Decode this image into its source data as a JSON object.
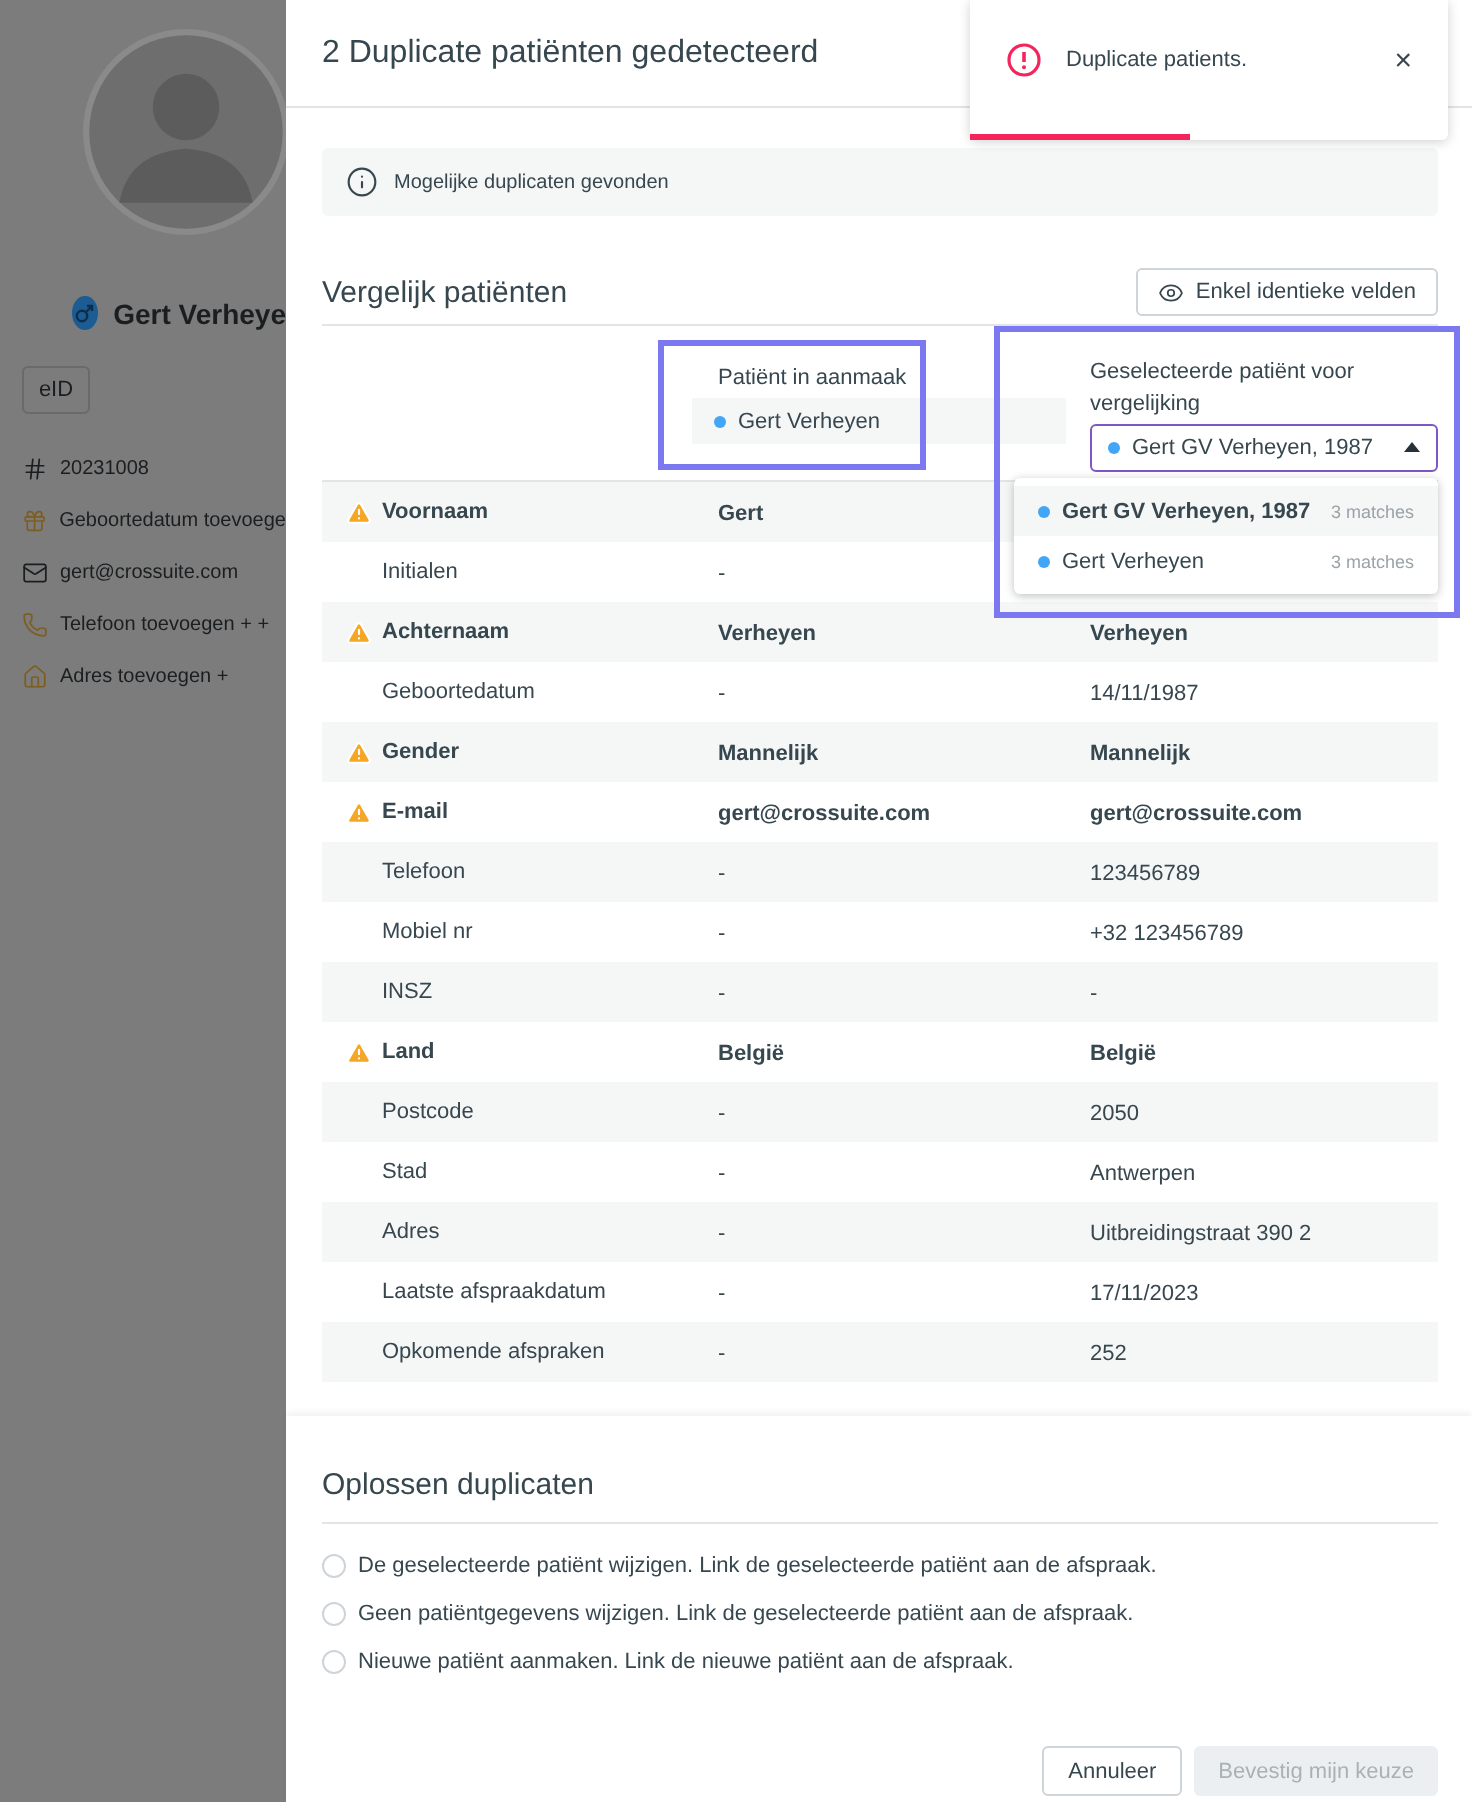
{
  "sidebar": {
    "name": "Gert Verheye",
    "eid_button": "eID",
    "items": [
      {
        "kind": "number",
        "text": "20231008"
      },
      {
        "kind": "birthday",
        "text": "Geboortedatum toevoege"
      },
      {
        "kind": "email",
        "text": "gert@crossuite.com"
      },
      {
        "kind": "phone",
        "text": "Telefoon toevoegen + +"
      },
      {
        "kind": "address",
        "text": "Adres toevoegen +"
      }
    ]
  },
  "dialog": {
    "title": "2 Duplicate patiënten gedetecteerd",
    "info": "Mogelijke duplicaten gevonden",
    "compare_title": "Vergelijk patiënten",
    "filter_button": "Enkel identieke velden",
    "created_column": {
      "label": "Patiënt in aanmaak",
      "patient": "Gert Verheyen"
    },
    "selected_column": {
      "label": "Geselecteerde patiënt voor vergelijking",
      "value": "Gert GV Verheyen, 1987",
      "options": [
        {
          "name": "Gert GV Verheyen, 1987",
          "matches": "3 matches",
          "selected": true
        },
        {
          "name": "Gert Verheyen",
          "matches": "3 matches",
          "selected": false
        }
      ]
    },
    "rows": [
      {
        "label": "Voornaam",
        "warning": true,
        "created": "Gert"
      },
      {
        "label": "Initialen",
        "warning": false,
        "created": "-"
      },
      {
        "label": "Achternaam",
        "warning": true,
        "created": "Verheyen",
        "selected": "Verheyen"
      },
      {
        "label": "Geboortedatum",
        "warning": false,
        "created": "-",
        "selected": "14/11/1987"
      },
      {
        "label": "Gender",
        "warning": true,
        "created": "Mannelijk",
        "selected": "Mannelijk"
      },
      {
        "label": "E-mail",
        "warning": true,
        "created": "gert@crossuite.com",
        "selected": "gert@crossuite.com"
      },
      {
        "label": "Telefoon",
        "warning": false,
        "created": "-",
        "selected": "123456789"
      },
      {
        "label": "Mobiel nr",
        "warning": false,
        "created": "-",
        "selected": "+32 123456789"
      },
      {
        "label": "INSZ",
        "warning": false,
        "created": "-",
        "selected": "-"
      },
      {
        "label": "Land",
        "warning": true,
        "created": "België",
        "selected": "België"
      },
      {
        "label": "Postcode",
        "warning": false,
        "created": "-",
        "selected": "2050"
      },
      {
        "label": "Stad",
        "warning": false,
        "created": "-",
        "selected": "Antwerpen"
      },
      {
        "label": "Adres",
        "warning": false,
        "created": "-",
        "selected": "Uitbreidingstraat 390 2"
      },
      {
        "label": "Laatste afspraakdatum",
        "warning": false,
        "created": "-",
        "selected": "17/11/2023"
      },
      {
        "label": "Opkomende afspraken",
        "warning": false,
        "created": "-",
        "selected": "252"
      }
    ],
    "resolve_title": "Oplossen duplicaten",
    "options": [
      {
        "text": "De geselecteerde patiënt wijzigen. Link de geselecteerde patiënt aan de afspraak.",
        "selected": false
      },
      {
        "text": "Geen patiëntgegevens wijzigen. Link de geselecteerde patiënt aan de afspraak.",
        "selected": false
      },
      {
        "text": "Nieuwe patiënt aanmaken. Link de nieuwe patiënt aan de afspraak.",
        "selected": false
      }
    ],
    "cancel_button": "Annuleer",
    "confirm_button": {
      "label": "Bevestig mijn keuze",
      "disabled": true
    }
  },
  "toast": {
    "message": "Duplicate patients.",
    "close": "×",
    "level": 0.46
  }
}
